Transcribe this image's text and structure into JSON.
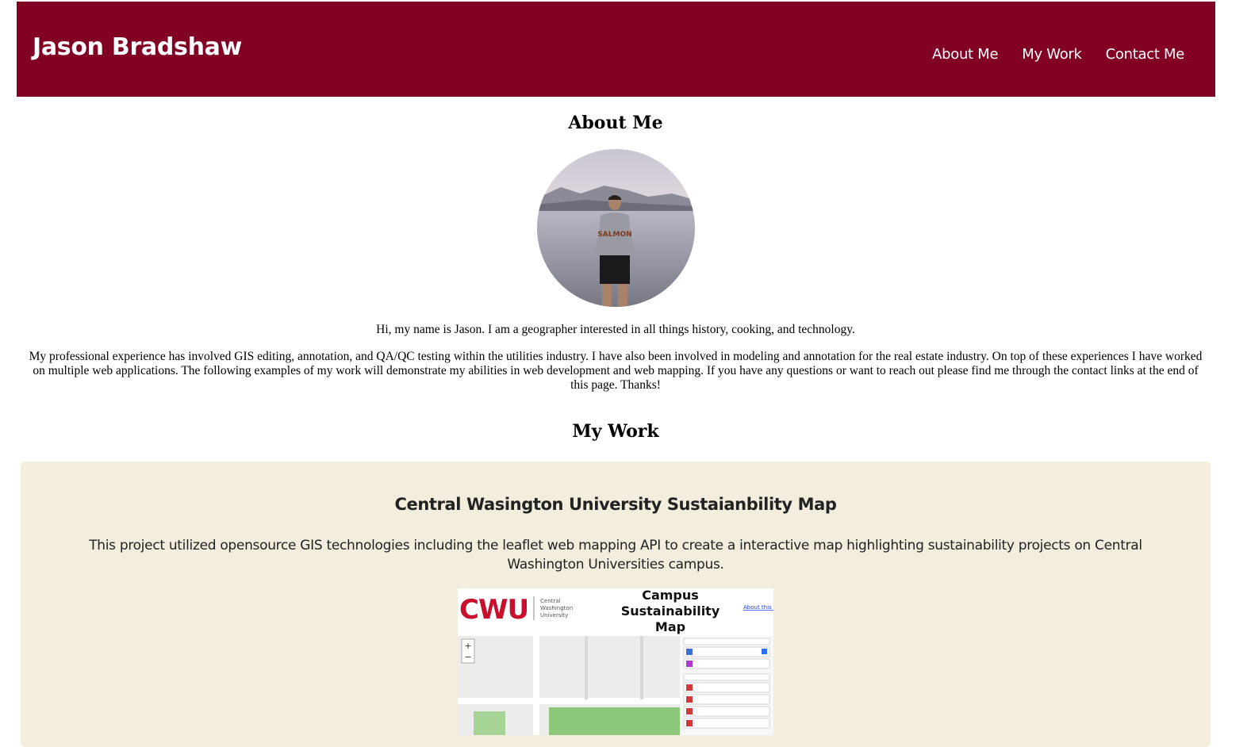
{
  "header": {
    "brand": "Jason Bradshaw",
    "nav": [
      "About Me",
      "My Work",
      "Contact Me"
    ],
    "background": "#820024"
  },
  "about": {
    "title": "About Me",
    "intro": "Hi, my name is Jason. I am a geographer interested in all things history, cooking, and technology.",
    "experience": "My professional experience has involved GIS editing, annotation, and QA/QC testing within the utilities industry. I have also been involved in modeling and annotation for the real estate industry. On top of these experiences I have worked on multiple web applications. The following examples of my work will demonstrate my abilities in web development and web mapping. If you have any questions or want to reach out please find me through the contact links at the end of this page. Thanks!"
  },
  "work": {
    "title": "My Work",
    "projects": [
      {
        "title": "Central Wasington University Sustaianbility Map",
        "description": "This project utilized opensource GIS technologies including the leaflet web mapping API to create a interactive map highlighting sustainability projects on Central Washington Universities campus.",
        "card_bg": "#f2eddc",
        "preview": {
          "logo_text": "CWU",
          "university_line1": "Central",
          "university_line2": "Washington",
          "university_line3": "University",
          "map_title_1": "Campus",
          "map_title_2": "Sustainability",
          "map_title_3": "Map",
          "about_link": "About this map",
          "zoom_in": "+",
          "zoom_out": "−"
        }
      }
    ]
  }
}
